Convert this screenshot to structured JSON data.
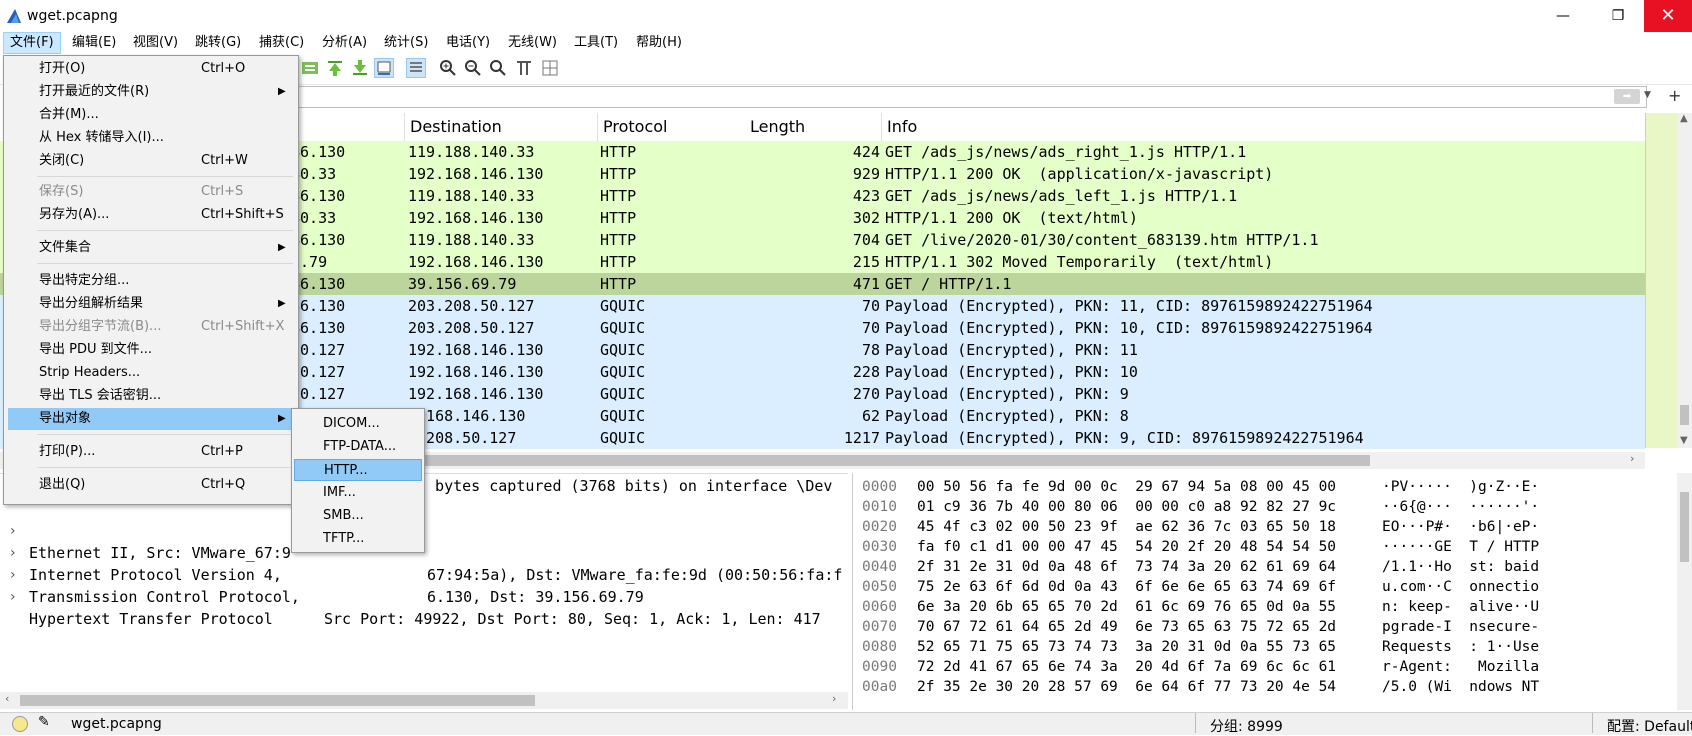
{
  "window": {
    "title": "wget.pcapng",
    "minimize": "—",
    "maximize": "❐",
    "close": "✕"
  },
  "menubar": [
    "文件(F)",
    "编辑(E)",
    "视图(V)",
    "跳转(G)",
    "捕获(C)",
    "分析(A)",
    "统计(S)",
    "电话(Y)",
    "无线(W)",
    "工具(T)",
    "帮助(H)"
  ],
  "file_menu": [
    {
      "label": "打开(O)",
      "shortcut": "Ctrl+O"
    },
    {
      "label": "打开最近的文件(R)",
      "submenu": true
    },
    {
      "label": "合并(M)..."
    },
    {
      "label": "从 Hex 转储导入(I)..."
    },
    {
      "label": "关闭(C)",
      "shortcut": "Ctrl+W"
    },
    {
      "label": "保存(S)",
      "shortcut": "Ctrl+S",
      "disabled": true
    },
    {
      "label": "另存为(A)...",
      "shortcut": "Ctrl+Shift+S"
    },
    {
      "label": "文件集合",
      "submenu": true
    },
    {
      "label": "导出特定分组..."
    },
    {
      "label": "导出分组解析结果",
      "submenu": true
    },
    {
      "label": "导出分组字节流(B)...",
      "shortcut": "Ctrl+Shift+X",
      "disabled": true
    },
    {
      "label": "导出 PDU 到文件..."
    },
    {
      "label": "Strip Headers..."
    },
    {
      "label": "导出 TLS 会话密钥..."
    },
    {
      "label": "导出对象",
      "submenu": true,
      "highlight": true
    },
    {
      "label": "打印(P)...",
      "shortcut": "Ctrl+P"
    },
    {
      "label": "退出(Q)",
      "shortcut": "Ctrl+Q"
    }
  ],
  "export_objects_submenu": [
    "DICOM...",
    "FTP-DATA...",
    "HTTP...",
    "IMF...",
    "SMB...",
    "TFTP..."
  ],
  "packet_list": {
    "columns": [
      "Destination",
      "Protocol",
      "Length",
      "Info"
    ],
    "rows": [
      {
        "src": "46.130",
        "dst": "119.188.140.33",
        "proto": "HTTP",
        "len": "424",
        "info": "GET /ads_js/news/ads_right_1.js HTTP/1.1",
        "color": "#e4ffc7"
      },
      {
        "src": "40.33",
        "dst": "192.168.146.130",
        "proto": "HTTP",
        "len": "929",
        "info": "HTTP/1.1 200 OK  (application/x-javascript)",
        "color": "#e4ffc7"
      },
      {
        "src": "46.130",
        "dst": "119.188.140.33",
        "proto": "HTTP",
        "len": "423",
        "info": "GET /ads_js/news/ads_left_1.js HTTP/1.1",
        "color": "#e4ffc7"
      },
      {
        "src": "40.33",
        "dst": "192.168.146.130",
        "proto": "HTTP",
        "len": "302",
        "info": "HTTP/1.1 200 OK  (text/html)",
        "color": "#e4ffc7"
      },
      {
        "src": "46.130",
        "dst": "119.188.140.33",
        "proto": "HTTP",
        "len": "704",
        "info": "GET /live/2020-01/30/content_683139.htm HTTP/1.1",
        "color": "#e4ffc7"
      },
      {
        "src": "9.79",
        "dst": "192.168.146.130",
        "proto": "HTTP",
        "len": "215",
        "info": "HTTP/1.1 302 Moved Temporarily  (text/html)",
        "color": "#e4ffc7"
      },
      {
        "src": "46.130",
        "dst": "39.156.69.79",
        "proto": "HTTP",
        "len": "471",
        "info": "GET / HTTP/1.1",
        "color": "#bcd59d"
      },
      {
        "src": "46.130",
        "dst": "203.208.50.127",
        "proto": "GQUIC",
        "len": "70",
        "info": "Payload (Encrypted), PKN: 11, CID: 8976159892422751964",
        "color": "#daeeff"
      },
      {
        "src": "46.130",
        "dst": "203.208.50.127",
        "proto": "GQUIC",
        "len": "70",
        "info": "Payload (Encrypted), PKN: 10, CID: 8976159892422751964",
        "color": "#daeeff"
      },
      {
        "src": "50.127",
        "dst": "192.168.146.130",
        "proto": "GQUIC",
        "len": "78",
        "info": "Payload (Encrypted), PKN: 11",
        "color": "#daeeff"
      },
      {
        "src": "50.127",
        "dst": "192.168.146.130",
        "proto": "GQUIC",
        "len": "228",
        "info": "Payload (Encrypted), PKN: 10",
        "color": "#daeeff"
      },
      {
        "src": "50.127",
        "dst": "192.168.146.130",
        "proto": "GQUIC",
        "len": "270",
        "info": "Payload (Encrypted), PKN: 9",
        "color": "#daeeff"
      },
      {
        "src": "",
        "dst": "2.168.146.130",
        "proto": "GQUIC",
        "len": "62",
        "info": "Payload (Encrypted), PKN: 8",
        "color": "#daeeff"
      },
      {
        "src": "",
        "dst": "3.208.50.127",
        "proto": "GQUIC",
        "len": "1217",
        "info": "Payload (Encrypted), PKN: 9, CID: 8976159892422751964",
        "color": "#daeeff"
      }
    ]
  },
  "details": [
    {
      "text": "1 bytes captured (3768 bits) on interface \\Dev",
      "indent": 425
    },
    {
      "text": "Ethernet II, Src: VMware_67:9",
      "suffix": "67:94:5a), Dst: VMware_fa:fe:9d (00:50:56:fa:f",
      "expander": true
    },
    {
      "text": "Internet Protocol Version 4,",
      "suffix": "6.130, Dst: 39.156.69.79",
      "expander": true
    },
    {
      "text": "Transmission Control Protocol,",
      "suffix": "Src Port: 49922, Dst Port: 80, Seq: 1, Ack: 1, Len: 417",
      "expander": true
    },
    {
      "text": "Hypertext Transfer Protocol",
      "expander": true
    }
  ],
  "hex_dump": [
    {
      "off": "0000",
      "bytes": "00 50 56 fa fe 9d 00 0c  29 67 94 5a 08 00 45 00",
      "ascii": "·PV·····  )g·Z··E·"
    },
    {
      "off": "0010",
      "bytes": "01 c9 36 7b 40 00 80 06  00 00 c0 a8 92 82 27 9c",
      "ascii": "··6{@···  ······'·"
    },
    {
      "off": "0020",
      "bytes": "45 4f c3 02 00 50 23 9f  ae 62 36 7c 03 65 50 18",
      "ascii": "EO···P#·  ·b6|·eP·"
    },
    {
      "off": "0030",
      "bytes": "fa f0 c1 d1 00 00 47 45  54 20 2f 20 48 54 54 50",
      "ascii": "······GE  T / HTTP"
    },
    {
      "off": "0040",
      "bytes": "2f 31 2e 31 0d 0a 48 6f  73 74 3a 20 62 61 69 64",
      "ascii": "/1.1··Ho  st: baid"
    },
    {
      "off": "0050",
      "bytes": "75 2e 63 6f 6d 0d 0a 43  6f 6e 6e 65 63 74 69 6f",
      "ascii": "u.com··C  onnectio"
    },
    {
      "off": "0060",
      "bytes": "6e 3a 20 6b 65 65 70 2d  61 6c 69 76 65 0d 0a 55",
      "ascii": "n: keep-  alive··U"
    },
    {
      "off": "0070",
      "bytes": "70 67 72 61 64 65 2d 49  6e 73 65 63 75 72 65 2d",
      "ascii": "pgrade-I  nsecure-"
    },
    {
      "off": "0080",
      "bytes": "52 65 71 75 65 73 74 73  3a 20 31 0d 0a 55 73 65",
      "ascii": "Requests  : 1··Use"
    },
    {
      "off": "0090",
      "bytes": "72 2d 41 67 65 6e 74 3a  20 4d 6f 7a 69 6c 6c 61",
      "ascii": "r-Agent:   Mozilla"
    },
    {
      "off": "00a0",
      "bytes": "2f 35 2e 30 20 28 57 69  6e 64 6f 77 73 20 4e 54",
      "ascii": "/5.0 (Wi  ndows NT"
    }
  ],
  "status": {
    "file": "wget.pcapng",
    "packets": "分组: 8999",
    "profile": "配置: Default"
  },
  "colors": {
    "http_row": "#e4ffc7",
    "selected_row": "#bcd59d",
    "gquic_row": "#daeeff",
    "menu_highlight": "#91c9f7"
  }
}
